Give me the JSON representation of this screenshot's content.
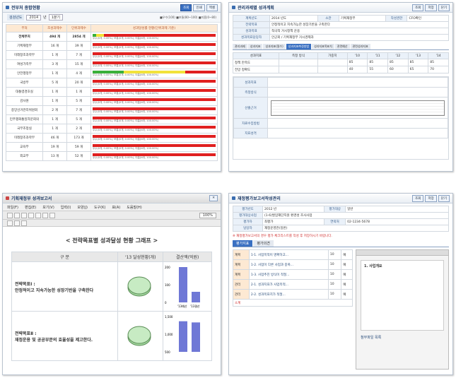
{
  "panel1": {
    "title": "전부처 종합현황",
    "buttons": [
      "조회",
      "인쇄",
      "엑셀"
    ],
    "filter_label": "검검년도",
    "year": "2014",
    "year_unit": "년",
    "term": "1분기",
    "legend": "■우수(100) ■보통(80~100) ■미흡(0~80)",
    "columns": [
      "부처",
      "조성과제수",
      "단위과제수",
      "성과달성률 현황(단위과제 기준)"
    ],
    "rows": [
      {
        "name": "전체부처",
        "a": "494 개",
        "b": "2854 개",
        "good": 3,
        "normal": 6,
        "bad": 91,
        "bold": true
      },
      {
        "name": "기획재정부",
        "a": "16 개",
        "b": "39 개",
        "good": 0,
        "normal": 0,
        "bad": 100
      },
      {
        "name": "미래창조과학부",
        "a": "1 개",
        "b": "7 개",
        "good": 0,
        "normal": 0,
        "bad": 100
      },
      {
        "name": "여성가족부",
        "a": "3 개",
        "b": "15 개",
        "good": 0,
        "normal": 0,
        "bad": 100
      },
      {
        "name": "안전행정부",
        "a": "1 개",
        "b": "4 개",
        "good": 25,
        "normal": 50,
        "bad": 25
      },
      {
        "name": "국방부",
        "a": "5 개",
        "b": "20 개",
        "good": 0,
        "normal": 0,
        "bad": 100
      },
      {
        "name": "대통령경호실",
        "a": "1 개",
        "b": "1 개",
        "good": 0,
        "normal": 0,
        "bad": 100
      },
      {
        "name": "감사원",
        "a": "1 개",
        "b": "5 개",
        "good": 0,
        "normal": 0,
        "bad": 100
      },
      {
        "name": "중앙선거관리위원회",
        "a": "2 개",
        "b": "7 개",
        "good": 0,
        "normal": 0,
        "bad": 100
      },
      {
        "name": "민주평화통일자문회의",
        "a": "1 개",
        "b": "5 개",
        "good": 0,
        "normal": 0,
        "bad": 100
      },
      {
        "name": "국무조정실",
        "a": "1 개",
        "b": "2 개",
        "good": 0,
        "normal": 0,
        "bad": 100
      },
      {
        "name": "미래창조과학부",
        "a": "46 개",
        "b": "173 개",
        "good": 0,
        "normal": 0,
        "bad": 100
      },
      {
        "name": "교육부",
        "a": "19 개",
        "b": "59 개",
        "good": 0,
        "normal": 0,
        "bad": 100
      },
      {
        "name": "외교부",
        "a": "13 개",
        "b": "52 개",
        "good": 0,
        "normal": 0,
        "bad": 100
      }
    ],
    "bar_text": "우수(0개, 0.00%), 보통(0개, 0.00%), 미흡(N개, 100.00%)"
  },
  "panel2": {
    "title": "관리과제별 성과계획",
    "buttons": [
      "조회",
      "저장",
      "닫기"
    ],
    "fields": [
      {
        "label": "계획년도",
        "value": "2014 년도"
      },
      {
        "label": "전략목표",
        "value": "안정적이고 지속가능한 성장기반을 구축한다"
      },
      {
        "label": "성과목표",
        "value": "적극적 거시정책 운용"
      },
      {
        "label": "성과목표담당자",
        "value": "안군회 / 기획재정부 거시경제과"
      }
    ],
    "side_labels": [
      {
        "label": "소관",
        "value": "기획재정부"
      },
      {
        "label": "작성권한",
        "value": "CFO확인"
      }
    ],
    "tabs": [
      "관리과제",
      "성과지표",
      "성과지표(필수)",
      "성과지표측정방법",
      "성과지표목표치",
      "관련예산",
      "관련성과지표"
    ],
    "section_labels": [
      "성과지표",
      "측정방식",
      "산출근거",
      "자료수집방법",
      "지표성격",
      "지표유형",
      "지표중요"
    ],
    "table_headers": [
      "성과지표",
      "측정 방식",
      "가중치",
      "'10",
      "'11",
      "'12",
      "'13",
      "'14"
    ],
    "years": [
      "'10",
      "'11",
      "'12",
      "'13",
      "'14"
    ],
    "indicator_rows": [
      {
        "name": "정책 만족도",
        "values": [
          "85",
          "85",
          "85",
          "85",
          "85"
        ]
      },
      {
        "name": "전망 정확도",
        "values": [
          "40",
          "55",
          "60",
          "65",
          "70"
        ]
      }
    ]
  },
  "panel3": {
    "title": "기획재정부 성과보고서",
    "menus": [
      "파일(F)",
      "편집(E)",
      "보기(V)",
      "입력(I)",
      "모양(J)",
      "도구(K)",
      "표(A)",
      "도움말(H)"
    ],
    "zoom": "100%",
    "heading": "< 전략목표별 성과달성 현황 그래프 >",
    "col1": "구 분",
    "col2": "'13 달성현황(개)",
    "col3": "결산액(억원)",
    "goal1": "전략목표Ⅰ :",
    "goal1_text": "안정적이고 지속가능한 성장기반을 구축한다",
    "goal2": "전략목표Ⅱ :",
    "goal2_text": "재정운용 및 공공부문의 효율성을 제고한다.",
    "bar1_values": [
      200,
      60
    ],
    "bar1_axis": [
      "200",
      "100",
      "0"
    ],
    "bar1_labels": [
      "'13예산",
      "'13결산"
    ],
    "bar2_axis": [
      "1,500",
      "1,000",
      "500"
    ],
    "bar2_values": [
      1300,
      1250
    ]
  },
  "panel4": {
    "title": "재정평가보고서작성관리",
    "buttons": [
      "조회",
      "저장",
      "닫기"
    ],
    "fields": [
      {
        "label": "평가년도",
        "value": "2012 년"
      },
      {
        "label": "평가대상사업",
        "value": "(1-6)발암재단지원 환경성 조사사업"
      },
      {
        "label": "평가대상",
        "value": "일반"
      },
      {
        "label": "평가자",
        "value": "최평가"
      },
      {
        "label": "담당자",
        "value": "재정운영관(일반)"
      },
      {
        "label": "연락처",
        "value": "02-1234-5678"
      }
    ],
    "notice": "※ 재정평가보고서의 경우 평가 체크리스트를 작성 후 저장하시기 바랍니다.",
    "tabs": [
      "평가지표",
      "평가의견"
    ],
    "section_A": "계획",
    "section_B": "관리",
    "section_C": "성과",
    "items": [
      "1-1. 사업목적이 명확하고...",
      "1-2. 사업이 다른 사업과 중복...",
      "1-3. 사업추진 방식이 적절...",
      "2-1. 성과지표가 사업목적...",
      "2-2. 성과목표치가 적절..."
    ],
    "points": [
      "10",
      "10",
      "10",
      "10",
      "10"
    ],
    "checks": [
      "예",
      "아니오"
    ],
    "subtotal": "소계",
    "doc_title": "1. 사업개요",
    "attach_label": "첨부파일 목록"
  }
}
